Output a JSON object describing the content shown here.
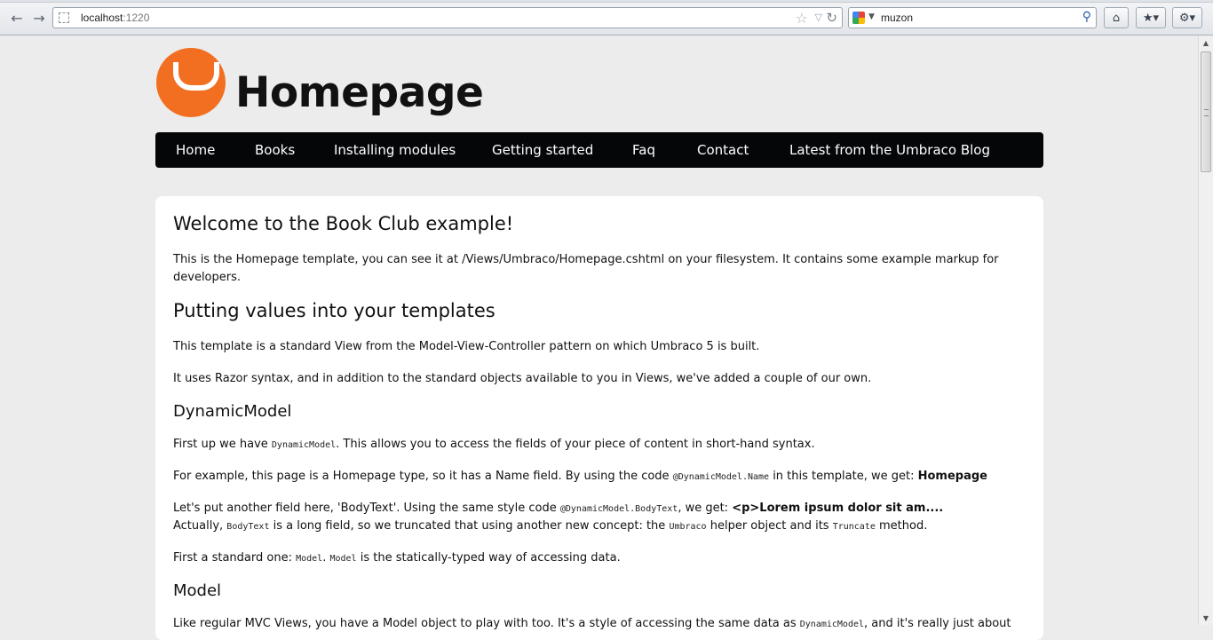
{
  "browser": {
    "url_host": "localhost",
    "url_port": ":1220",
    "search_query": "muzon",
    "icons": [
      "back-icon",
      "forward-icon",
      "star-icon",
      "reload-icon",
      "search-icon",
      "home-icon",
      "bookmarks-icon",
      "addon-icon"
    ]
  },
  "site": {
    "title": "Homepage",
    "brand_color": "#f26f21",
    "nav": [
      "Home",
      "Books",
      "Installing modules",
      "Getting started",
      "Faq",
      "Contact",
      "Latest from the Umbraco Blog"
    ]
  },
  "content": {
    "h_welcome": "Welcome to the Book Club example!",
    "p_intro": "This is the Homepage template, you can see it at /Views/Umbraco/Homepage.cshtml on your filesystem. It contains some example markup for developers.",
    "h_values": "Putting values into your templates",
    "p_mvc": "This template is a standard View from the Model-View-Controller pattern on which Umbraco 5 is built.",
    "p_razor": "It uses Razor syntax, and in addition to the standard objects available to you in Views, we've added a couple of our own.",
    "h_dynamic": "DynamicModel",
    "p_first": {
      "a": "First up we have ",
      "code": "DynamicModel",
      "b": ". This allows you to access the fields of your piece of content in short-hand syntax."
    },
    "p_example": {
      "a": "For example, this page is a Homepage type, so it has a Name field. By using the code ",
      "code": "@DynamicModel.Name",
      "b": " in this template, we get: ",
      "bold": "Homepage"
    },
    "p_another": {
      "a": "Let's put another field here, 'BodyText'. Using the same style code ",
      "code": "@DynamicModel.BodyText",
      "b": ", we get: ",
      "bold": "<p>Lorem ipsum dolor sit am...."
    },
    "p_actually": {
      "a": "Actually, ",
      "code1": "BodyText",
      "b": " is a long field, so we truncated that using another new concept: the ",
      "code2": "Umbraco",
      "c": " helper object and its ",
      "code3": "Truncate",
      "d": " method."
    },
    "p_standard": {
      "a": "First a standard one: ",
      "code1": "Model",
      "b": ". ",
      "code2": "Model",
      "c": " is the statically-typed way of accessing data."
    },
    "h_model": "Model",
    "p_model": {
      "a": "Like regular MVC Views, you have a Model object to play with too. It's a style of accessing the same data as ",
      "code": "DynamicModel",
      "b": ", and it's really just about"
    }
  }
}
